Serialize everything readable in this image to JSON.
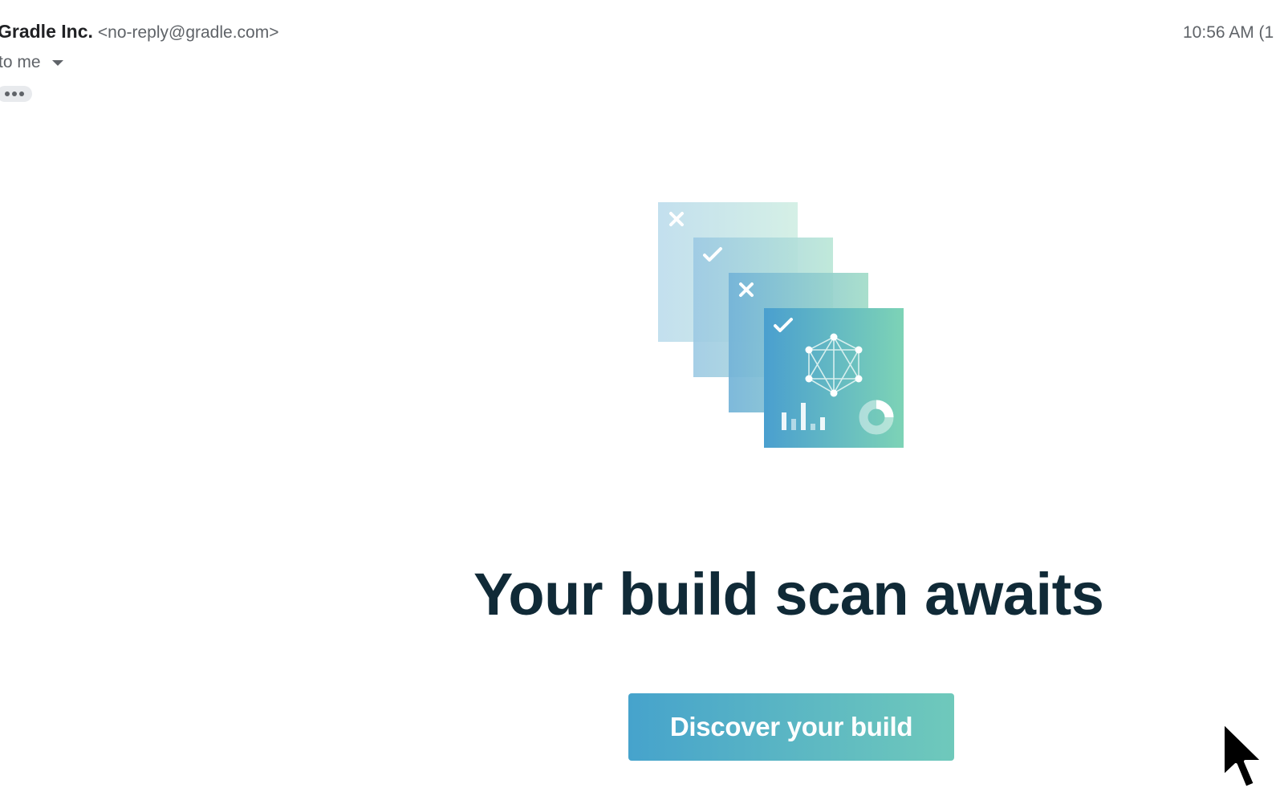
{
  "email": {
    "sender_name": "Gradle Inc.",
    "sender_address": "<no-reply@gradle.com>",
    "recipient": "to me",
    "timestamp": "10:56 AM (1"
  },
  "hero": {
    "image_icon": "build-scan-layers-illustration",
    "colors": {
      "gradient_start": "#46a3cc",
      "gradient_end": "#78d3b4"
    }
  },
  "content": {
    "headline": "Your build scan awaits",
    "cta_label": "Discover your build"
  },
  "colors": {
    "headline": "#102a37",
    "cta_start": "#46a3cc",
    "cta_end": "#6fc9bb"
  }
}
